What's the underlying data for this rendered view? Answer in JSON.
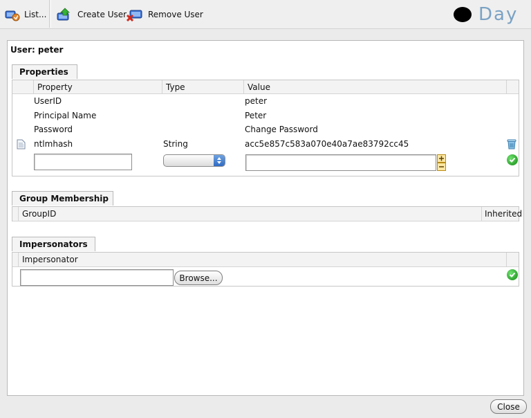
{
  "toolbar": {
    "list_label": "List...",
    "create_label": "Create User",
    "remove_label": "Remove User",
    "logo_text": "Day"
  },
  "dialog": {
    "user_title": "User: peter",
    "properties": {
      "title": "Properties",
      "columns": [
        "Property",
        "Type",
        "Value"
      ],
      "rows": [
        {
          "property": "UserID",
          "type": "",
          "value": "peter"
        },
        {
          "property": "Principal Name",
          "type": "",
          "value": "Peter"
        },
        {
          "property": "Password",
          "type": "",
          "value": "Change Password"
        },
        {
          "property": "ntlmhash",
          "type": "String",
          "value": "acc5e857c583a070e40a7ae83792cc45"
        }
      ]
    },
    "group_membership": {
      "title": "Group Membership",
      "columns": [
        "GroupID",
        "Inherited"
      ]
    },
    "impersonators": {
      "title": "Impersonators",
      "column": "Impersonator",
      "browse_label": "Browse..."
    },
    "close_label": "Close"
  },
  "colors": {
    "accent": "#7aa2c4",
    "ok_green": "#1f9a1f"
  }
}
